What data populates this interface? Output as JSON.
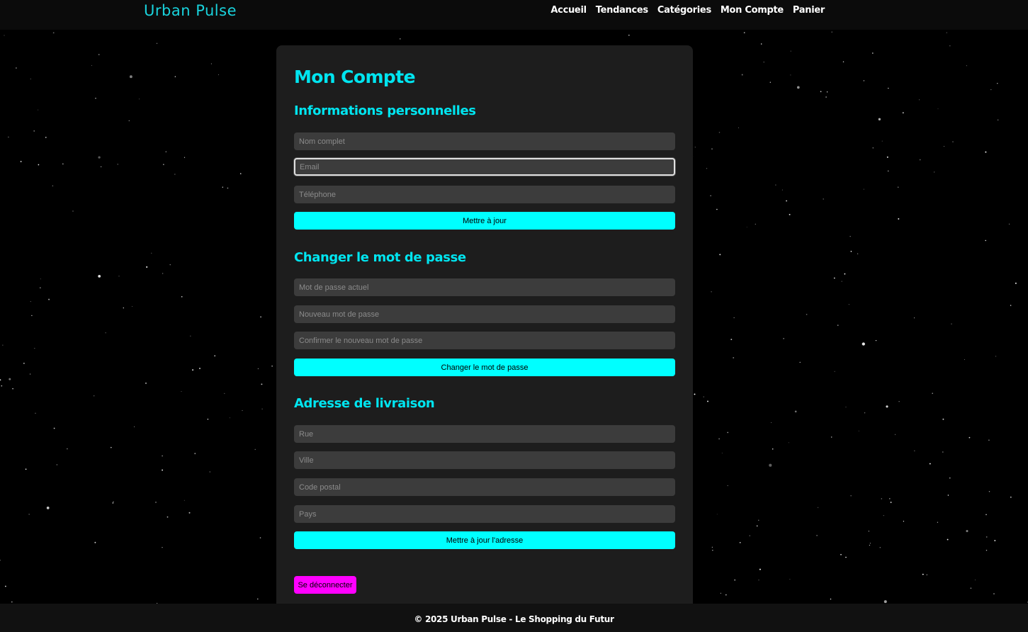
{
  "header": {
    "logo": "Urban Pulse",
    "nav": [
      "Accueil",
      "Tendances",
      "Catégories",
      "Mon Compte",
      "Panier"
    ]
  },
  "account": {
    "title": "Mon Compte",
    "personal": {
      "title": "Informations personnelles",
      "name_placeholder": "Nom complet",
      "email_placeholder": "Email",
      "phone_placeholder": "Téléphone",
      "submit_label": "Mettre à jour"
    },
    "password": {
      "title": "Changer le mot de passe",
      "current_placeholder": "Mot de passe actuel",
      "new_placeholder": "Nouveau mot de passe",
      "confirm_placeholder": "Confirmer le nouveau mot de passe",
      "submit_label": "Changer le mot de passe"
    },
    "address": {
      "title": "Adresse de livraison",
      "street_placeholder": "Rue",
      "city_placeholder": "Ville",
      "postal_placeholder": "Code postal",
      "country_placeholder": "Pays",
      "submit_label": "Mettre à jour l'adresse"
    },
    "logout_label": "Se déconnecter"
  },
  "footer": {
    "text": "© 2025 Urban Pulse - Le Shopping du Futur"
  },
  "colors": {
    "accent": "#00ffff",
    "heading": "#00e5f0",
    "logout": "#ff00ff",
    "panel": "#1d1d1d"
  }
}
